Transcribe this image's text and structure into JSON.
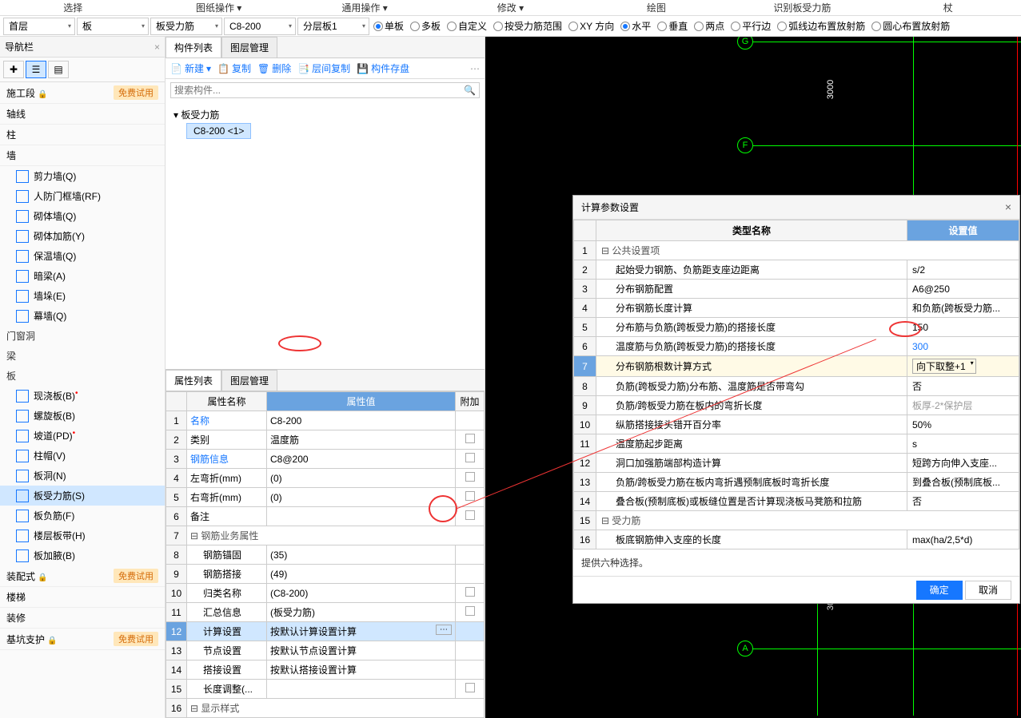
{
  "menu": [
    "选择",
    "图纸操作",
    "通用操作",
    "修改",
    "绘图",
    "识别板受力筋",
    "杖"
  ],
  "toolbar": {
    "dd1": "首层",
    "dd2": "板",
    "dd3": "板受力筋",
    "dd4": "C8-200",
    "dd5": "分层板1",
    "radios1": [
      {
        "l": "单板",
        "c": true
      },
      {
        "l": "多板",
        "c": false
      },
      {
        "l": "自定义",
        "c": false
      },
      {
        "l": "按受力筋范围",
        "c": false
      },
      {
        "l": "XY 方向",
        "c": false
      }
    ],
    "radios2": [
      {
        "l": "水平",
        "c": true
      },
      {
        "l": "垂直",
        "c": false
      },
      {
        "l": "两点",
        "c": false
      },
      {
        "l": "平行边",
        "c": false
      },
      {
        "l": "弧线边布置放射筋",
        "c": false
      },
      {
        "l": "圆心布置放射筋",
        "c": false
      }
    ]
  },
  "nav": {
    "title": "导航栏",
    "sections": [
      {
        "label": "施工段",
        "badge": "免费试用",
        "lock": true
      },
      {
        "label": "轴线"
      },
      {
        "label": "柱"
      },
      {
        "label": "墙"
      }
    ],
    "wall_items": [
      {
        "l": "剪力墙(Q)"
      },
      {
        "l": "人防门框墙(RF)"
      },
      {
        "l": "砌体墙(Q)"
      },
      {
        "l": "砌体加筋(Y)"
      },
      {
        "l": "保温墙(Q)"
      },
      {
        "l": "暗梁(A)"
      },
      {
        "l": "墙垛(E)"
      },
      {
        "l": "幕墙(Q)"
      }
    ],
    "cat2": "门窗洞",
    "cat3": "梁",
    "cat4": "板",
    "slab_items": [
      {
        "l": "现浇板(B)",
        "dot": true
      },
      {
        "l": "螺旋板(B)"
      },
      {
        "l": "坡道(PD)",
        "dot": true
      },
      {
        "l": "柱帽(V)"
      },
      {
        "l": "板洞(N)"
      },
      {
        "l": "板受力筋(S)",
        "active": true
      },
      {
        "l": "板负筋(F)"
      },
      {
        "l": "楼层板带(H)"
      },
      {
        "l": "板加腋(B)"
      }
    ],
    "bottom": [
      {
        "l": "装配式",
        "badge": "免费试用",
        "lock": true
      },
      {
        "l": "楼梯"
      },
      {
        "l": "装修"
      },
      {
        "l": "基坑支护",
        "badge": "免费试用",
        "lock": true
      }
    ]
  },
  "comp": {
    "tabs": [
      "构件列表",
      "图层管理"
    ],
    "btns": [
      "新建",
      "复制",
      "删除",
      "层间复制",
      "构件存盘"
    ],
    "search_ph": "搜索构件...",
    "tree_root": "板受力筋",
    "tree_leaf": "C8-200 <1>"
  },
  "prop": {
    "tabs": [
      "属性列表",
      "图层管理"
    ],
    "th": [
      "",
      "属性名称",
      "属性值",
      "附加"
    ],
    "rows": [
      {
        "n": 1,
        "name": "名称",
        "val": "C8-200",
        "blue": true
      },
      {
        "n": 2,
        "name": "类别",
        "val": "温度筋",
        "chk": true,
        "circle": true
      },
      {
        "n": 3,
        "name": "钢筋信息",
        "val": "C8@200",
        "blue": true,
        "chk": true
      },
      {
        "n": 4,
        "name": "左弯折(mm)",
        "val": "(0)",
        "chk": true
      },
      {
        "n": 5,
        "name": "右弯折(mm)",
        "val": "(0)",
        "chk": true
      },
      {
        "n": 6,
        "name": "备注",
        "val": "",
        "chk": true
      },
      {
        "n": 7,
        "group": "钢筋业务属性"
      },
      {
        "n": 8,
        "sub": true,
        "name": "钢筋锚固",
        "val": "(35)"
      },
      {
        "n": 9,
        "sub": true,
        "name": "钢筋搭接",
        "val": "(49)"
      },
      {
        "n": 10,
        "sub": true,
        "name": "归类名称",
        "val": "(C8-200)",
        "chk": true
      },
      {
        "n": 11,
        "sub": true,
        "name": "汇总信息",
        "val": "(板受力筋)",
        "chk": true
      },
      {
        "n": 12,
        "sub": true,
        "name": "计算设置",
        "val": "按默认计算设置计算",
        "sel": true,
        "btn": true,
        "circleBtn": true
      },
      {
        "n": 13,
        "sub": true,
        "name": "节点设置",
        "val": "按默认节点设置计算"
      },
      {
        "n": 14,
        "sub": true,
        "name": "搭接设置",
        "val": "按默认搭接设置计算"
      },
      {
        "n": 15,
        "sub": true,
        "name": "长度调整(...",
        "val": "",
        "chk": true
      },
      {
        "n": 16,
        "group": "显示样式"
      }
    ]
  },
  "dialog": {
    "title": "计算参数设置",
    "th": [
      "",
      "类型名称",
      "设置值"
    ],
    "rows": [
      {
        "n": 1,
        "group": "公共设置项"
      },
      {
        "n": 2,
        "name": "起始受力钢筋、负筋距支座边距离",
        "val": "s/2"
      },
      {
        "n": 3,
        "name": "分布钢筋配置",
        "val": "A6@250"
      },
      {
        "n": 4,
        "name": "分布钢筋长度计算",
        "val": "和负筋(跨板受力筋..."
      },
      {
        "n": 5,
        "name": "分布筋与负筋(跨板受力筋)的搭接长度",
        "val": "150"
      },
      {
        "n": 6,
        "name": "温度筋与负筋(跨板受力筋)的搭接长度",
        "val": "300",
        "circle": true,
        "blue": true
      },
      {
        "n": 7,
        "name": "分布钢筋根数计算方式",
        "val": "向下取整+1",
        "sel": true,
        "dd": true
      },
      {
        "n": 8,
        "name": "负筋(跨板受力筋)分布筋、温度筋是否带弯勾",
        "val": "否"
      },
      {
        "n": 9,
        "name": "负筋/跨板受力筋在板内的弯折长度",
        "val": "板厚-2*保护层",
        "gray": true
      },
      {
        "n": 10,
        "name": "纵筋搭接接头错开百分率",
        "val": "50%"
      },
      {
        "n": 11,
        "name": "温度筋起步距离",
        "val": "s"
      },
      {
        "n": 12,
        "name": "洞口加强筋端部构造计算",
        "val": "短跨方向伸入支座..."
      },
      {
        "n": 13,
        "name": "负筋/跨板受力筋在板内弯折遇预制底板时弯折长度",
        "val": "到叠合板(预制底板..."
      },
      {
        "n": 14,
        "name": "叠合板(预制底板)或板缝位置是否计算现浇板马凳筋和拉筋",
        "val": "否"
      },
      {
        "n": 15,
        "group": "受力筋"
      },
      {
        "n": 16,
        "name": "板底钢筋伸入支座的长度",
        "val": "max(ha/2,5*d)"
      }
    ],
    "hint": "提供六种选择。",
    "ok": "确定",
    "cancel": "取消"
  },
  "canvas": {
    "g": "G",
    "f": "F",
    "a": "A",
    "dim": "3000"
  }
}
